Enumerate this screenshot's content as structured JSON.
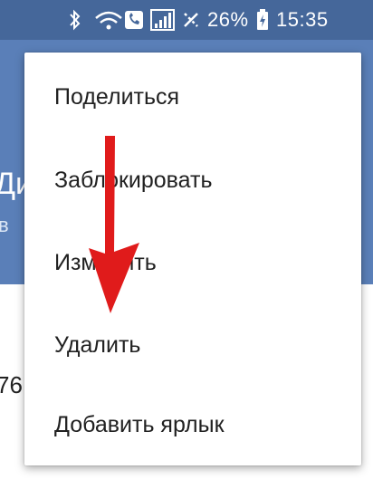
{
  "status_bar": {
    "battery_percent": "26%",
    "time": "15:35",
    "icons": [
      "bluetooth-icon",
      "wifi-call-icon",
      "signal-icon",
      "alarm-icon",
      "battery-charging-icon"
    ]
  },
  "header": {
    "title_fragment": "Ди",
    "subtitle_fragment": "в"
  },
  "content": {
    "number_fragment": "76"
  },
  "menu": {
    "items": [
      {
        "label": "Поделиться"
      },
      {
        "label": "Заблокировать"
      },
      {
        "label": "Изменить"
      },
      {
        "label": "Удалить"
      },
      {
        "label": "Добавить ярлык"
      }
    ]
  },
  "colors": {
    "status_bar": "#45679a",
    "header": "#5a7fb8",
    "annotation_arrow": "#e01b1b"
  }
}
